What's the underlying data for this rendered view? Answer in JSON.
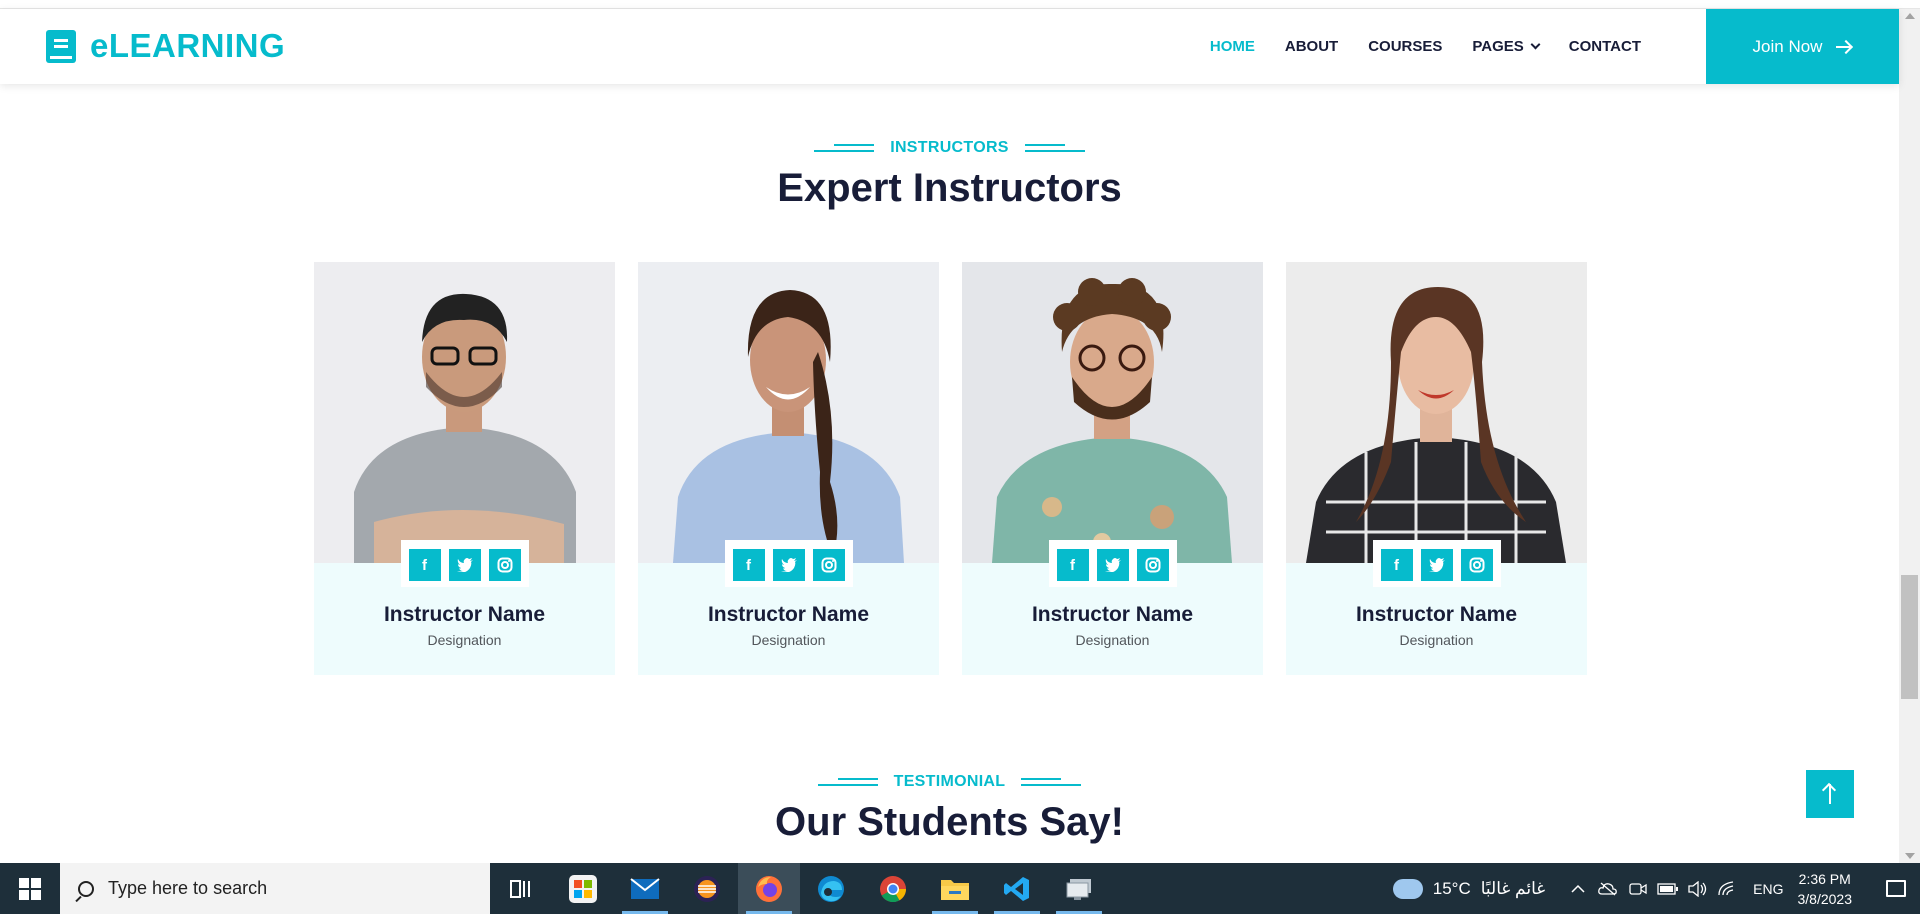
{
  "navbar": {
    "brand": "eLEARNING",
    "links": [
      {
        "label": "HOME",
        "active": true
      },
      {
        "label": "ABOUT",
        "active": false
      },
      {
        "label": "COURSES",
        "active": false
      },
      {
        "label": "PAGES",
        "active": false,
        "dropdown": true
      },
      {
        "label": "CONTACT",
        "active": false
      }
    ],
    "join_label": "Join Now"
  },
  "instructors": {
    "label": "INSTRUCTORS",
    "title": "Expert Instructors",
    "cards": [
      {
        "name": "Instructor Name",
        "designation": "Designation"
      },
      {
        "name": "Instructor Name",
        "designation": "Designation"
      },
      {
        "name": "Instructor Name",
        "designation": "Designation"
      },
      {
        "name": "Instructor Name",
        "designation": "Designation"
      }
    ],
    "social_icons": [
      "facebook-icon",
      "twitter-icon",
      "instagram-icon"
    ]
  },
  "testimonial": {
    "label": "TESTIMONIAL",
    "title": "Our Students Say!"
  },
  "taskbar": {
    "search_placeholder": "Type here to search",
    "apps": [
      "task-view-icon",
      "store-icon",
      "mail-icon",
      "eclipse-icon",
      "firefox-icon",
      "edge-icon",
      "chrome-icon",
      "file-explorer-icon",
      "vscode-icon",
      "remote-desktop-icon"
    ],
    "weather_temp": "15°C",
    "weather_text": "غائم غالبًا",
    "language": "ENG",
    "time": "2:36 PM",
    "date": "3/8/2023"
  },
  "colors": {
    "accent": "#06BBCC",
    "dark": "#181d38",
    "card_bg": "#eefcfd",
    "taskbar": "#1e2f3a"
  }
}
